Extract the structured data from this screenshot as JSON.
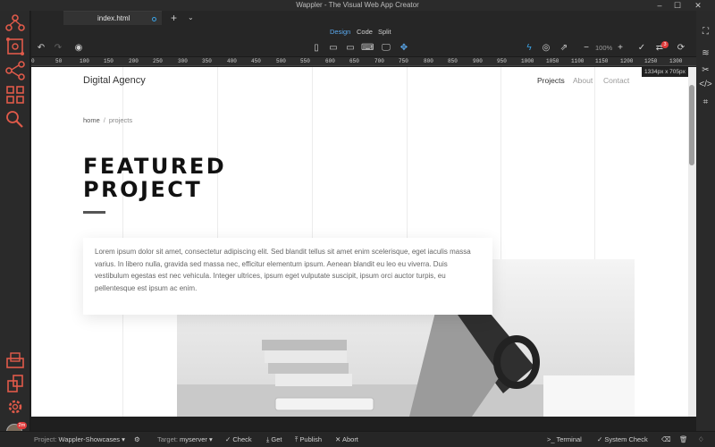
{
  "window": {
    "title": "Wappler - The Visual Web App Creator"
  },
  "tabs": {
    "active": "index.html"
  },
  "view_modes": {
    "design": "Design",
    "code": "Code",
    "split": "Split",
    "active": "design"
  },
  "toolbar": {
    "zoom": "100%",
    "notification_count": "3"
  },
  "ruler": {
    "ticks": [
      "0",
      "50",
      "100",
      "150",
      "200",
      "250",
      "300",
      "350",
      "400",
      "450",
      "500",
      "550",
      "600",
      "650",
      "700",
      "750",
      "800",
      "850",
      "900",
      "950",
      "1000",
      "1050",
      "1100",
      "1150",
      "1200",
      "1250",
      "1300"
    ]
  },
  "canvas_size": "1334px x 705px",
  "page": {
    "brand": "Digital Agency",
    "nav": [
      "Projects",
      "About",
      "Contact"
    ],
    "breadcrumb": {
      "home": "home",
      "separator": "/",
      "current": "projects"
    },
    "heading_line1": "FEATURED",
    "heading_line2": "PROJECT",
    "body_text": "Lorem ipsum dolor sit amet, consectetur adipiscing elit. Sed blandit tellus sit amet enim scelerisque, eget iaculis massa varius. In libero nulla, gravida sed massa nec, efficitur elementum ipsum. Aenean blandit eu leo eu viverra. Duis vestibulum egestas est nec vehicula. Integer ultrices, ipsum eget vulputate suscipit, ipsum orci auctor turpis, eu pellentesque est ipsum ac enim."
  },
  "statusbar": {
    "project_label": "Project:",
    "project": "Wappler-Showcases",
    "target_label": "Target:",
    "target": "myserver",
    "check": "Check",
    "get": "Get",
    "publish": "Publish",
    "abort": "Abort",
    "terminal": "Terminal",
    "system_check": "System Check",
    "avatar_badge": "2m"
  },
  "colors": {
    "accent": "#3aa3e6",
    "alert": "#e03c3c",
    "sidebar_icon": "#e05a4a"
  }
}
